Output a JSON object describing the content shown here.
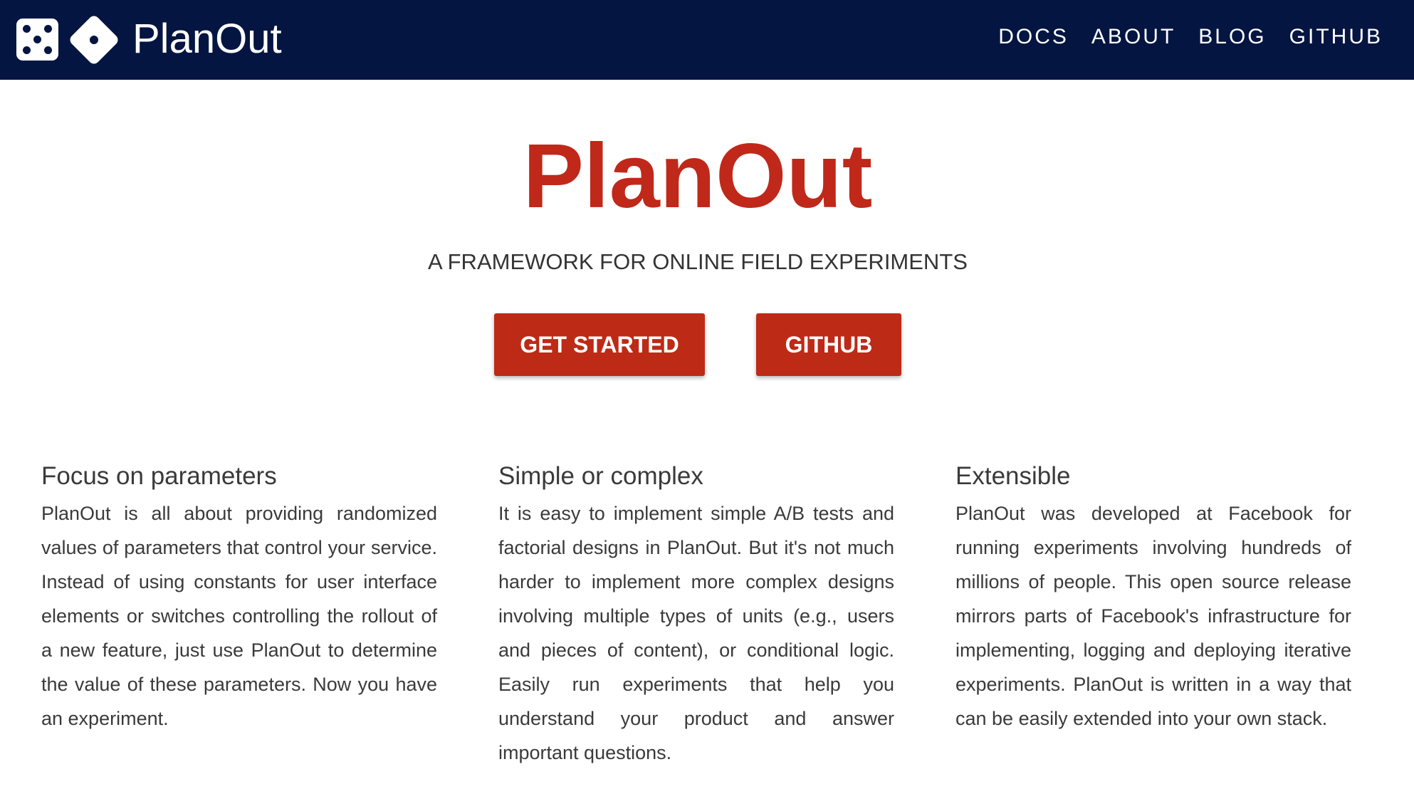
{
  "header": {
    "brand": "PlanOut",
    "logo_icons": [
      "dice-square-icon",
      "dice-diamond-icon"
    ],
    "nav": [
      {
        "label": "DOCS"
      },
      {
        "label": "ABOUT"
      },
      {
        "label": "BLOG"
      },
      {
        "label": "GITHUB"
      }
    ],
    "background_color": "#051541"
  },
  "hero": {
    "title": "PlanOut",
    "subtitle": "A FRAMEWORK FOR ONLINE FIELD EXPERIMENTS",
    "primary_button": "GET STARTED",
    "secondary_button": "GITHUB",
    "accent_color": "#c0281a"
  },
  "features": [
    {
      "title": "Focus on parameters",
      "body": "PlanOut is all about providing randomized values of parameters that control your service. Instead of using constants for user interface elements or switches controlling the rollout of a new feature, just use PlanOut to determine the value of these parameters. Now you have an experiment."
    },
    {
      "title": "Simple or complex",
      "body": "It is easy to implement simple A/B tests and factorial designs in PlanOut. But it's not much harder to implement more complex designs involving multiple types of units (e.g., users and pieces of content), or conditional logic. Easily run experiments that help you understand your product and answer important questions."
    },
    {
      "title": "Extensible",
      "body": "PlanOut was developed at Facebook for running experiments involving hundreds of millions of people. This open source release mirrors parts of Facebook's infrastructure for implementing, logging and deploying iterative experiments. PlanOut is written in a way that can be easily extended into your own stack."
    }
  ]
}
